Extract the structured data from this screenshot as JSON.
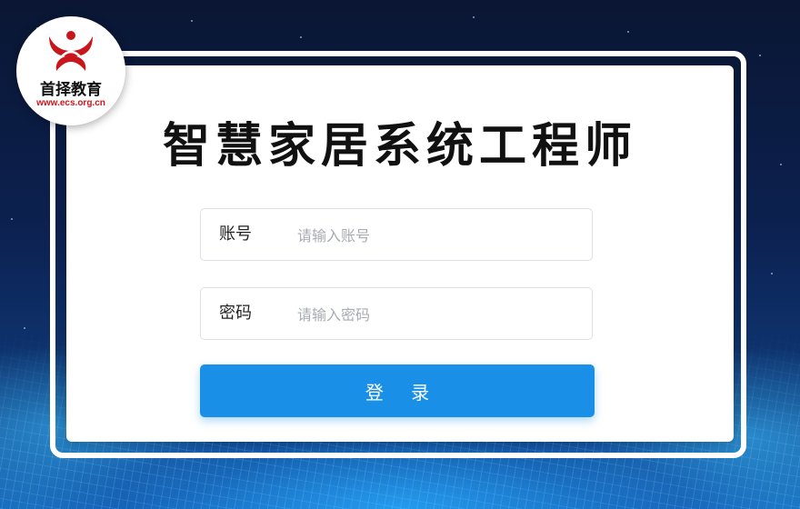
{
  "logo": {
    "name_cn": "首择教育",
    "url": "www.ecs.org.cn",
    "brand_color": "#c8161d"
  },
  "title": "智慧家居系统工程师",
  "form": {
    "account": {
      "label": "账号",
      "placeholder": "请输入账号"
    },
    "password": {
      "label": "密码",
      "placeholder": "请输入密码"
    },
    "login_label": "登 录"
  },
  "colors": {
    "primary": "#1a8fe8",
    "background": "#0b1a3c"
  }
}
